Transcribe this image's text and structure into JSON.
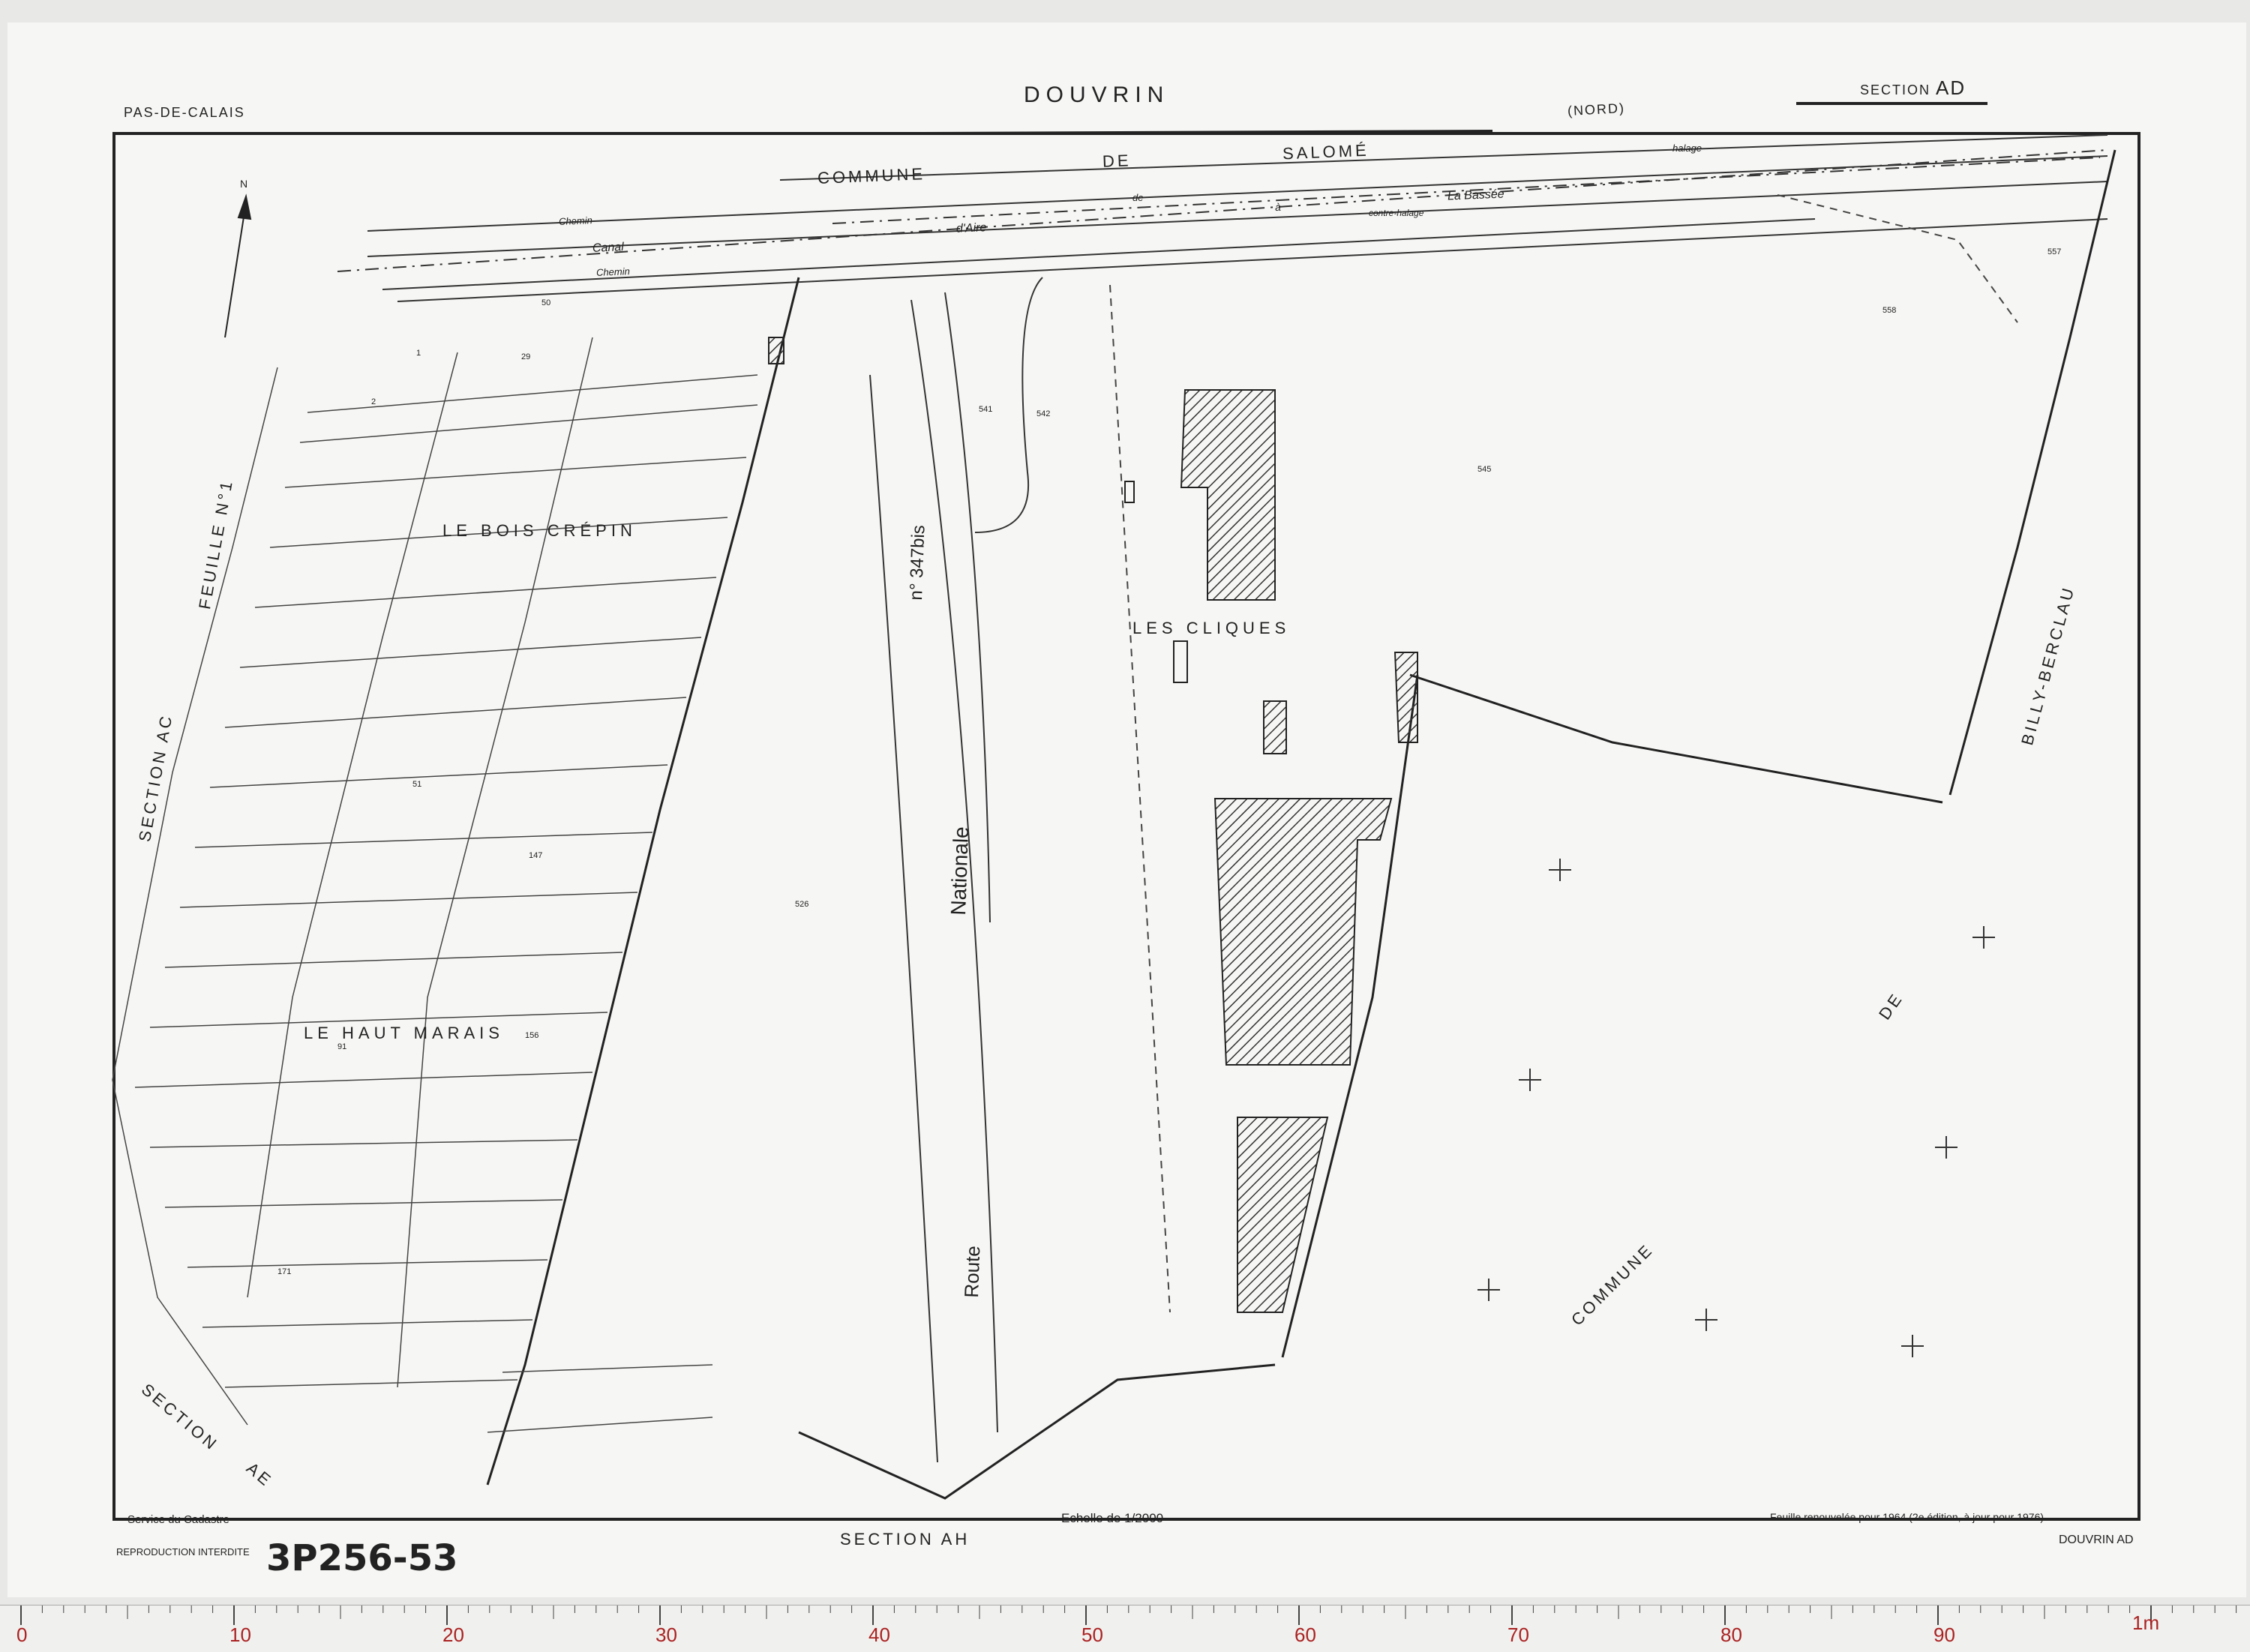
{
  "header": {
    "department": "PAS-DE-CALAIS",
    "commune": "DOUVRIN",
    "section_label": "SECTION",
    "section_code": "AD",
    "north_label": "N"
  },
  "neighbours": {
    "top_commune": [
      "COMMUNE",
      "DE",
      "SALOMÉ"
    ],
    "top_note": "(NORD)",
    "right_commune": "BILLY-BERCLAU",
    "bottom_right_commune": [
      "COMMUNE",
      "DE"
    ],
    "left_section": "SECTION AC",
    "left_sheet": "FEUILLE N°1",
    "bottom_left_section": [
      "SECTION",
      "AE"
    ],
    "bottom_section": "SECTION AH"
  },
  "places": {
    "bois_crepin": "LE BOIS CRÉPIN",
    "haut_marais": "LE HAUT MARAIS",
    "cliques": "LES CLIQUES"
  },
  "route": {
    "word1": "Route",
    "word2": "Nationale",
    "number": "n° 347bis"
  },
  "waterway": {
    "canal": "Canal",
    "d_aire": "d'Aire",
    "a": "à",
    "la_bassee": "La Bassée",
    "de": "de",
    "chemin_top": "Chemin",
    "chemin_bottom": "Chemin",
    "halage": "halage",
    "contre_halage": "contre-halage"
  },
  "footer": {
    "service": "Service du Cadastre",
    "reproduction": "REPRODUCTION INTERDITE",
    "scale": "Echelle de 1/2000",
    "renewal": "Feuille renouvelée pour 1964  (2e édition, à jour pour 1976)",
    "sheet_ref": "DOUVRIN AD",
    "handwritten": "3P256-53"
  },
  "parcels": {
    "p545": "545",
    "p558": "558",
    "p557": "557",
    "p541": "541",
    "p542": "542",
    "p526": "526",
    "p50": "50",
    "p1": "1",
    "p2": "2",
    "p29": "29",
    "p51": "51",
    "p91": "91",
    "p147": "147",
    "p156": "156",
    "p171": "171"
  },
  "ruler": {
    "unit_end": "1m",
    "major_labels": [
      "0",
      "10",
      "20",
      "30",
      "40",
      "50",
      "60",
      "70",
      "80",
      "90"
    ]
  }
}
